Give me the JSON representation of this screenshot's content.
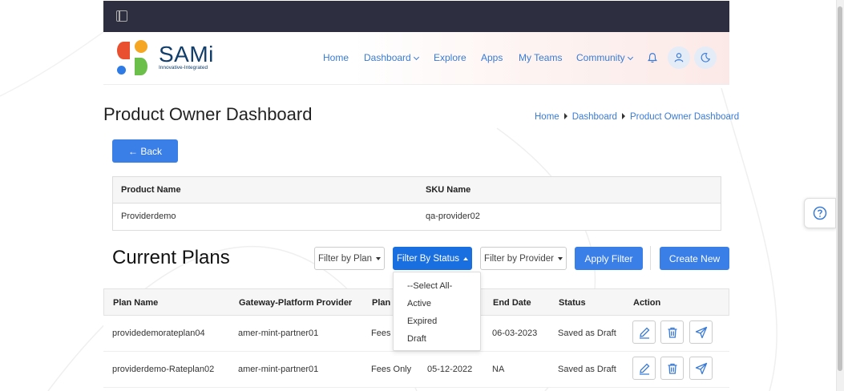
{
  "topbar": {
    "sidebar_toggle_icon": "sidebar-toggle-icon"
  },
  "logo": {
    "text": "SAMi",
    "tagline": "Innovative-Integrated"
  },
  "nav": {
    "items": [
      {
        "label": "Home"
      },
      {
        "label": "Dashboard"
      },
      {
        "label": "Explore"
      },
      {
        "label": "Apps"
      },
      {
        "label": "My Teams"
      },
      {
        "label": "Community"
      }
    ]
  },
  "page": {
    "title": "Product Owner Dashboard"
  },
  "breadcrumb": {
    "items": [
      "Home",
      "Dashboard",
      "Product Owner Dashboard"
    ]
  },
  "back_button": {
    "label": "← Back"
  },
  "product_table": {
    "headers": [
      "Product Name",
      "SKU Name"
    ],
    "row": [
      "Providerdemo",
      "qa-provider02"
    ]
  },
  "plans": {
    "title": "Current Plans",
    "filters": {
      "plan": "Filter by Plan",
      "status": "Filter By Status",
      "provider": "Filter by Provider"
    },
    "apply_label": "Apply Filter",
    "create_label": "Create New",
    "status_options": [
      "--Select All-",
      "Active",
      "Expired",
      "Draft"
    ],
    "headers": [
      "Plan Name",
      "Gateway-Platform Provider",
      "Plan T",
      "End Date",
      "Status",
      "Action"
    ],
    "rows": [
      {
        "name": "providedemorateplan04",
        "provider": "amer-mint-partner01",
        "type": "Fees (",
        "start": "",
        "end": "06-03-2023",
        "status": "Saved as Draft"
      },
      {
        "name": "providerdemo-Rateplan02",
        "provider": "amer-mint-partner01",
        "type": "Fees Only",
        "start": "05-12-2022",
        "end": "NA",
        "status": "Saved as Draft"
      }
    ]
  },
  "colors": {
    "accent": "#3a7ee8",
    "topbar": "#2d2e3f",
    "link": "#3a7bd5"
  }
}
